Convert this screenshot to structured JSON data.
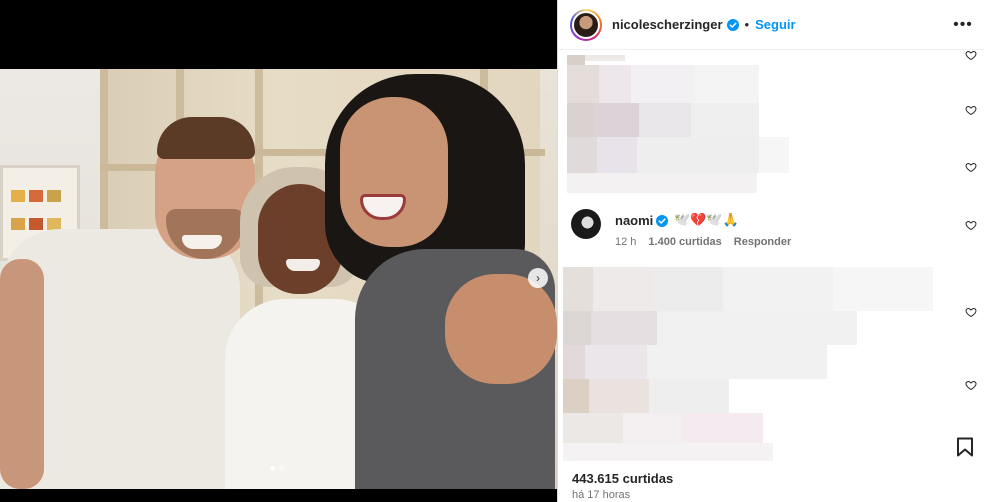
{
  "post": {
    "author": "nicolescherzinger",
    "follow_label": "Seguir",
    "separator": "•",
    "more_label": "•••",
    "likes": "443.615 curtidas",
    "time": "há 17 horas"
  },
  "comment": {
    "user": "naomi",
    "text": "🕊️💔🕊️🙏",
    "time": "12 h",
    "likes": "1.400 curtidas",
    "reply_label": "Responder"
  },
  "colors": {
    "accent": "#0095f6",
    "text": "#262626",
    "muted": "#737373",
    "verified": "#0095f6"
  },
  "icons": {
    "verified": "verified-badge-icon",
    "heart": "heart-outline-icon",
    "save": "bookmark-icon",
    "more": "more-options-icon",
    "next": "chevron-right-icon"
  },
  "carousel": {
    "next_label": "›"
  }
}
